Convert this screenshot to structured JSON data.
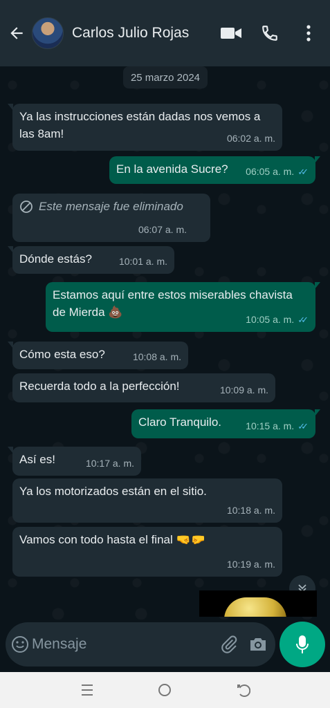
{
  "header": {
    "contact_name": "Carlos Julio Rojas"
  },
  "chat": {
    "date_chip": "25 marzo 2024",
    "messages": [
      {
        "dir": "in",
        "text_lines": [
          "Ya las instrucciones están dadas nos vemos a",
          "las 8am!"
        ],
        "time": "06:02 a. m."
      },
      {
        "dir": "out",
        "text": "En la avenida Sucre?",
        "time": "06:05 a. m.",
        "ticks": "✓✓"
      },
      {
        "dir": "in",
        "text": "Este mensaje fue eliminado",
        "time": "06:07 a. m.",
        "deleted": true
      },
      {
        "dir": "in",
        "text": "Dónde estás?",
        "time": "10:01 a. m."
      },
      {
        "dir": "out",
        "text_lines": [
          "Estamos aquí entre estos miserables chavista",
          "de Mierda 💩"
        ],
        "time": "10:05 a. m.",
        "ticks": "✓✓"
      },
      {
        "dir": "in",
        "text": "Cómo esta eso?",
        "time": "10:08 a. m."
      },
      {
        "dir": "in",
        "text": "Recuerda todo a la perfección!",
        "time": "10:09 a. m."
      },
      {
        "dir": "out",
        "text": "Claro Tranquilo.",
        "time": "10:15 a. m.",
        "ticks": "✓✓"
      },
      {
        "dir": "in",
        "text": "Así es!",
        "time": "10:17 a. m."
      },
      {
        "dir": "in",
        "text": "Ya los motorizados están en el  sitio.",
        "time": "10:18 a. m."
      },
      {
        "dir": "in",
        "text": "Vamos con todo hasta el final 🤜🤛",
        "time": "10:19 a. m."
      }
    ]
  },
  "composer": {
    "placeholder": "Mensaje"
  },
  "icons": {
    "back": "arrow-left-icon",
    "video": "video-camera-icon",
    "call": "phone-icon",
    "menu": "more-vertical-icon",
    "emoji": "emoji-icon",
    "attach": "paperclip-icon",
    "camera": "camera-icon",
    "mic": "microphone-icon",
    "scroll": "chevron-double-down-icon"
  },
  "colors": {
    "header_bg": "#1f2c34",
    "chat_bg": "#0b141a",
    "incoming_bubble": "#1f2c34",
    "outgoing_bubble": "#005c4b",
    "accent": "#00a884",
    "read_ticks": "#53bdeb"
  }
}
